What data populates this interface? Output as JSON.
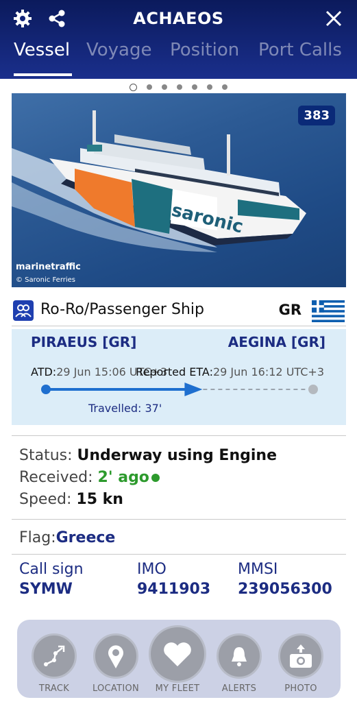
{
  "header": {
    "title": "ACHAEOS",
    "tabs": [
      {
        "label": "Vessel",
        "active": true
      },
      {
        "label": "Voyage",
        "active": false
      },
      {
        "label": "Position",
        "active": false
      },
      {
        "label": "Port Calls",
        "active": false
      }
    ],
    "icons": [
      "gear-icon",
      "share-icon",
      "close-icon"
    ]
  },
  "photo": {
    "count": "383",
    "watermark": "marinetraffic",
    "credit": "© Saronic Ferries",
    "hull_text": "saronic",
    "pages": 7,
    "active_page": 1
  },
  "vessel": {
    "type": "Ro-Ro/Passenger Ship",
    "flag_code": "GR"
  },
  "voyage": {
    "from": "PIRAEUS [GR]",
    "to": "AEGINA [GR]",
    "atd_label": "ATD:",
    "atd_value": "29 Jun 15:06 UTC+3",
    "eta_label": "Reported ETA:",
    "eta_value": "29 Jun 16:12 UTC+3",
    "travelled": "Travelled: 37'",
    "progress": 0.56
  },
  "status": {
    "status_label": "Status:",
    "status_value": "Underway using Engine",
    "received_label": "Received:",
    "received_value": "2' ago",
    "speed_label": "Speed:",
    "speed_value": "15 kn",
    "flag_label": "Flag:",
    "flag_value": "Greece"
  },
  "ids": {
    "callsign_label": "Call sign",
    "callsign_value": "SYMW",
    "imo_label": "IMO",
    "imo_value": "9411903",
    "mmsi_label": "MMSI",
    "mmsi_value": "239056300"
  },
  "toolbar": {
    "items": [
      {
        "label": "TRACK",
        "icon": "track-icon"
      },
      {
        "label": "LOCATION",
        "icon": "location-pin-icon"
      },
      {
        "label": "MY FLEET",
        "icon": "heart-icon"
      },
      {
        "label": "ALERTS",
        "icon": "bell-icon"
      },
      {
        "label": "PHOTO",
        "icon": "camera-upload-icon"
      }
    ]
  },
  "colors": {
    "header_bg": "#0b1a5c",
    "accent_blue": "#1c2c82",
    "status_green": "#2d9a2d",
    "voyage_bg": "#dcedf8"
  }
}
